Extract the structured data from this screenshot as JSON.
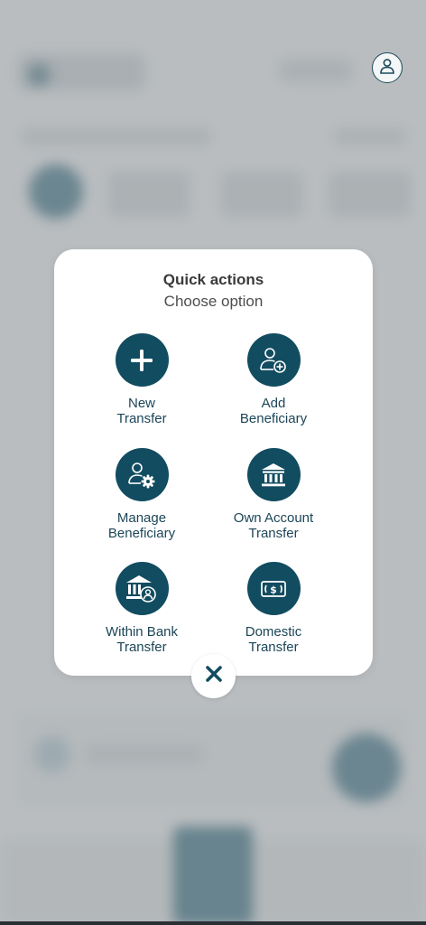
{
  "modal": {
    "title": "Quick actions",
    "subtitle": "Choose option"
  },
  "actions": [
    {
      "label": "New\nTransfer",
      "icon": "plus-icon"
    },
    {
      "label": "Add\nBeneficiary",
      "icon": "add-user-icon"
    },
    {
      "label": "Manage\nBeneficiary",
      "icon": "user-settings-icon"
    },
    {
      "label": "Own Account\nTransfer",
      "icon": "bank-icon"
    },
    {
      "label": "Within Bank\nTransfer",
      "icon": "bank-user-icon"
    },
    {
      "label": "Domestic\nTransfer",
      "icon": "dollar-bill-icon"
    }
  ],
  "colors": {
    "primary": "#124c60",
    "label": "#1c4658",
    "modal_bg": "#ffffff",
    "backdrop": "#c6c9cb"
  }
}
